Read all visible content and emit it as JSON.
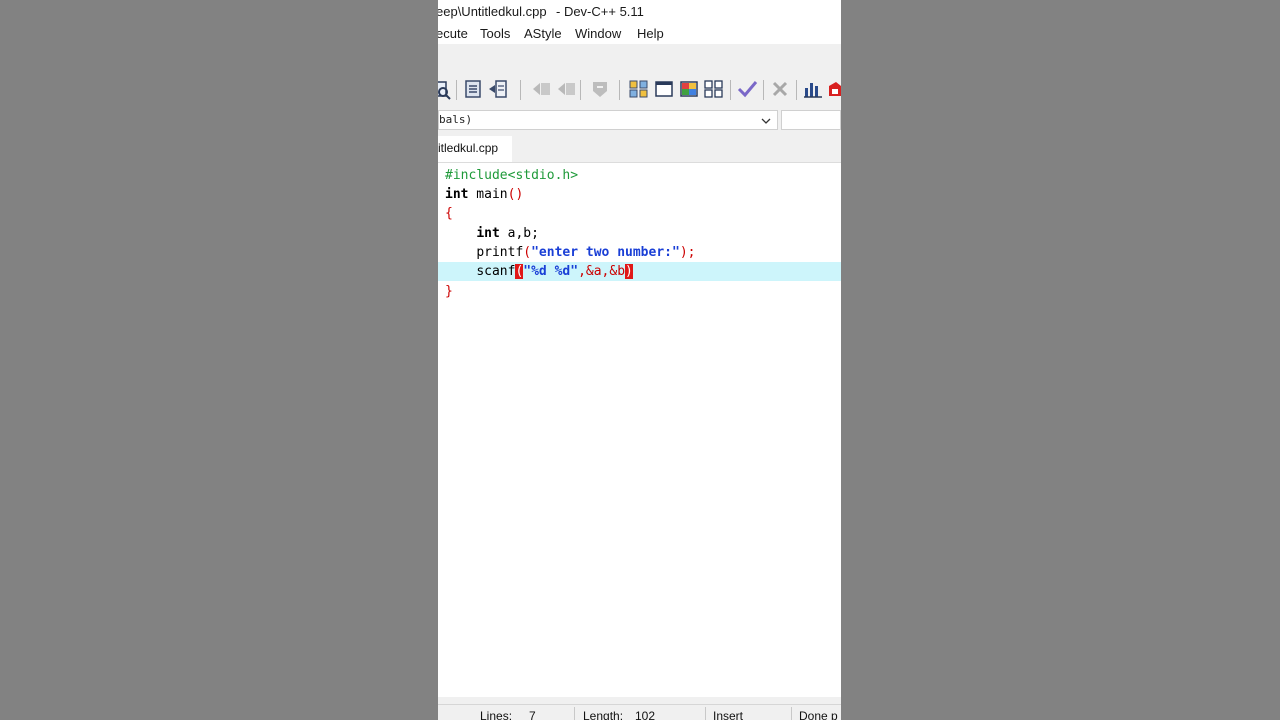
{
  "window": {
    "title_path": "eep\\Untitledkul.cpp",
    "title_app": "- Dev-C++ 5.11"
  },
  "menu": [
    "ecute",
    "Tools",
    "AStyle",
    "Window",
    "Help"
  ],
  "toolbar_icons": [
    "find-icon",
    "save-all-icon",
    "close-file-icon",
    "indent-left-icon",
    "unindent-icon",
    "toggle-bookmark-icon",
    "new-project-icon",
    "window-icon",
    "class-view-icon",
    "grid-icon",
    "compile-check-icon",
    "stop-icon",
    "chart-icon",
    "debug-icon"
  ],
  "scope": {
    "value": "bals)"
  },
  "tab": {
    "label": "itledkul.cpp"
  },
  "editor": {
    "lines": [
      "#include<stdio.h>",
      "int main()",
      "{",
      "    int a,b;",
      "    printf(\"enter two number:\");",
      "    scanf(\"%d %d\",&a,&b)",
      "}"
    ],
    "tokens": {
      "include": "#include<stdio.h>",
      "int": "int",
      "main": " main",
      "parens": "()",
      "open_brace": "{",
      "close_brace": "}",
      "indent": "    ",
      "decl_rest": " a,b;",
      "printf": "printf",
      "printf_open": "(",
      "printf_str": "\"enter two number:\"",
      "printf_close": ");",
      "scanf": "scanf",
      "scanf_open": "(",
      "scanf_str": "\"%d %d\"",
      "scanf_args": ",&a,&b",
      "scanf_close": ")"
    },
    "highlighted_line": 6
  },
  "status": {
    "lines_label": "Lines:",
    "lines_value": "7",
    "length_label": "Length:",
    "length_value": "102",
    "mode": "Insert",
    "message": "Done p"
  },
  "colors": {
    "background": "#828282",
    "editor_bg": "#ffffff",
    "line_highlight": "#cdf5fb",
    "preprocessor": "#1f9a3a",
    "string": "#1a3fd6",
    "brace": "#cc0000",
    "brace_match": "#e01818"
  }
}
